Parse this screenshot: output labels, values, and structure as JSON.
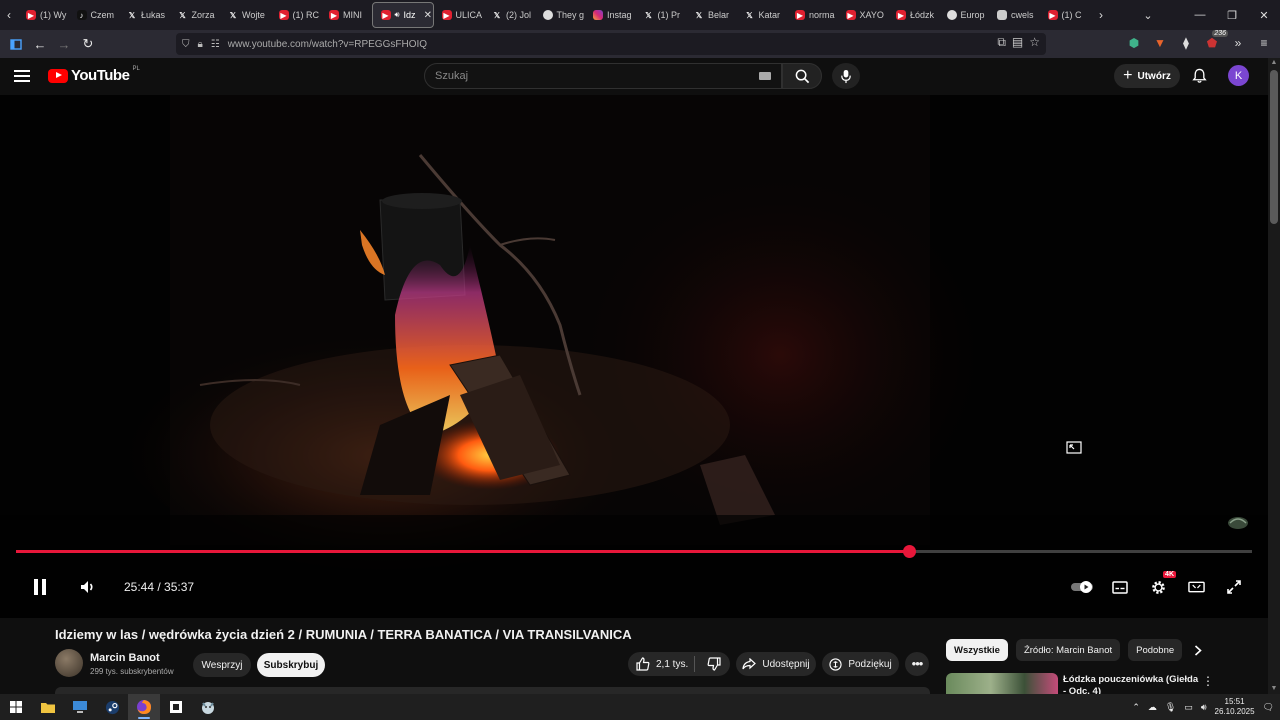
{
  "browser": {
    "tabs": [
      {
        "icon": "youtube",
        "label": "(1) Wy"
      },
      {
        "icon": "tiktok",
        "label": "Czem"
      },
      {
        "icon": "x",
        "label": "Łukas"
      },
      {
        "icon": "x",
        "label": "Zorza"
      },
      {
        "icon": "x",
        "label": "Wojte"
      },
      {
        "icon": "youtube",
        "label": "(1) RC"
      },
      {
        "icon": "youtube",
        "label": "MINI"
      },
      {
        "icon": "youtube",
        "label": "Idz",
        "active": true
      },
      {
        "icon": "youtube",
        "label": "ULICA"
      },
      {
        "icon": "x",
        "label": "(2) Jol"
      },
      {
        "icon": "threads",
        "label": "They g"
      },
      {
        "icon": "instagram",
        "label": "Instag"
      },
      {
        "icon": "x",
        "label": "(1) Pr"
      },
      {
        "icon": "x",
        "label": "Belar"
      },
      {
        "icon": "x",
        "label": "Katar"
      },
      {
        "icon": "youtube",
        "label": "norma"
      },
      {
        "icon": "youtube",
        "label": "XAYO"
      },
      {
        "icon": "youtube",
        "label": "Łódzk"
      },
      {
        "icon": "threads",
        "label": "Europ"
      },
      {
        "icon": "sheet",
        "label": "cwels"
      },
      {
        "icon": "youtube",
        "label": "(1) C"
      }
    ],
    "url": "www.youtube.com/watch?v=RPEGGsFHOIQ",
    "extension_badge": "236",
    "colors": {
      "tab_bg": "#1c1b22",
      "toolbar_bg": "#2b2a33"
    }
  },
  "youtube": {
    "logo_text": "YouTube",
    "country_code": "PL",
    "search_placeholder": "Szukaj",
    "create_label": "Utwórz",
    "avatar_letter": "K",
    "colors": {
      "accent": "#e8173a",
      "avatar": "#7b46d1"
    }
  },
  "player": {
    "time_current": "25:44",
    "time_total": "35:37",
    "time_display": "25:44 / 35:37",
    "progress": 0.7226,
    "quality_badge": "4K",
    "state": "playing"
  },
  "video": {
    "title": "Idziemy w las / wędrówka życia dzień 2 / RUMUNIA / TERRA BANATICA / VIA TRANSILVANICA",
    "channel_name": "Marcin Banot",
    "subscribers": "299 tys. subskrybentów",
    "support_label": "Wesprzyj",
    "subscribe_label": "Subskrybuj",
    "likes": "2,1 tys.",
    "share_label": "Udostępnij",
    "thanks_label": "Podziękuj"
  },
  "sidebar": {
    "chips": [
      "Wszystkie",
      "Źródło: Marcin Banot",
      "Podobne"
    ],
    "recommendation": {
      "title": "Łódzka pouczeniówka (Giełda - Odc. 4)"
    }
  },
  "taskbar": {
    "time": "15:51",
    "date": "26.10.2025"
  }
}
